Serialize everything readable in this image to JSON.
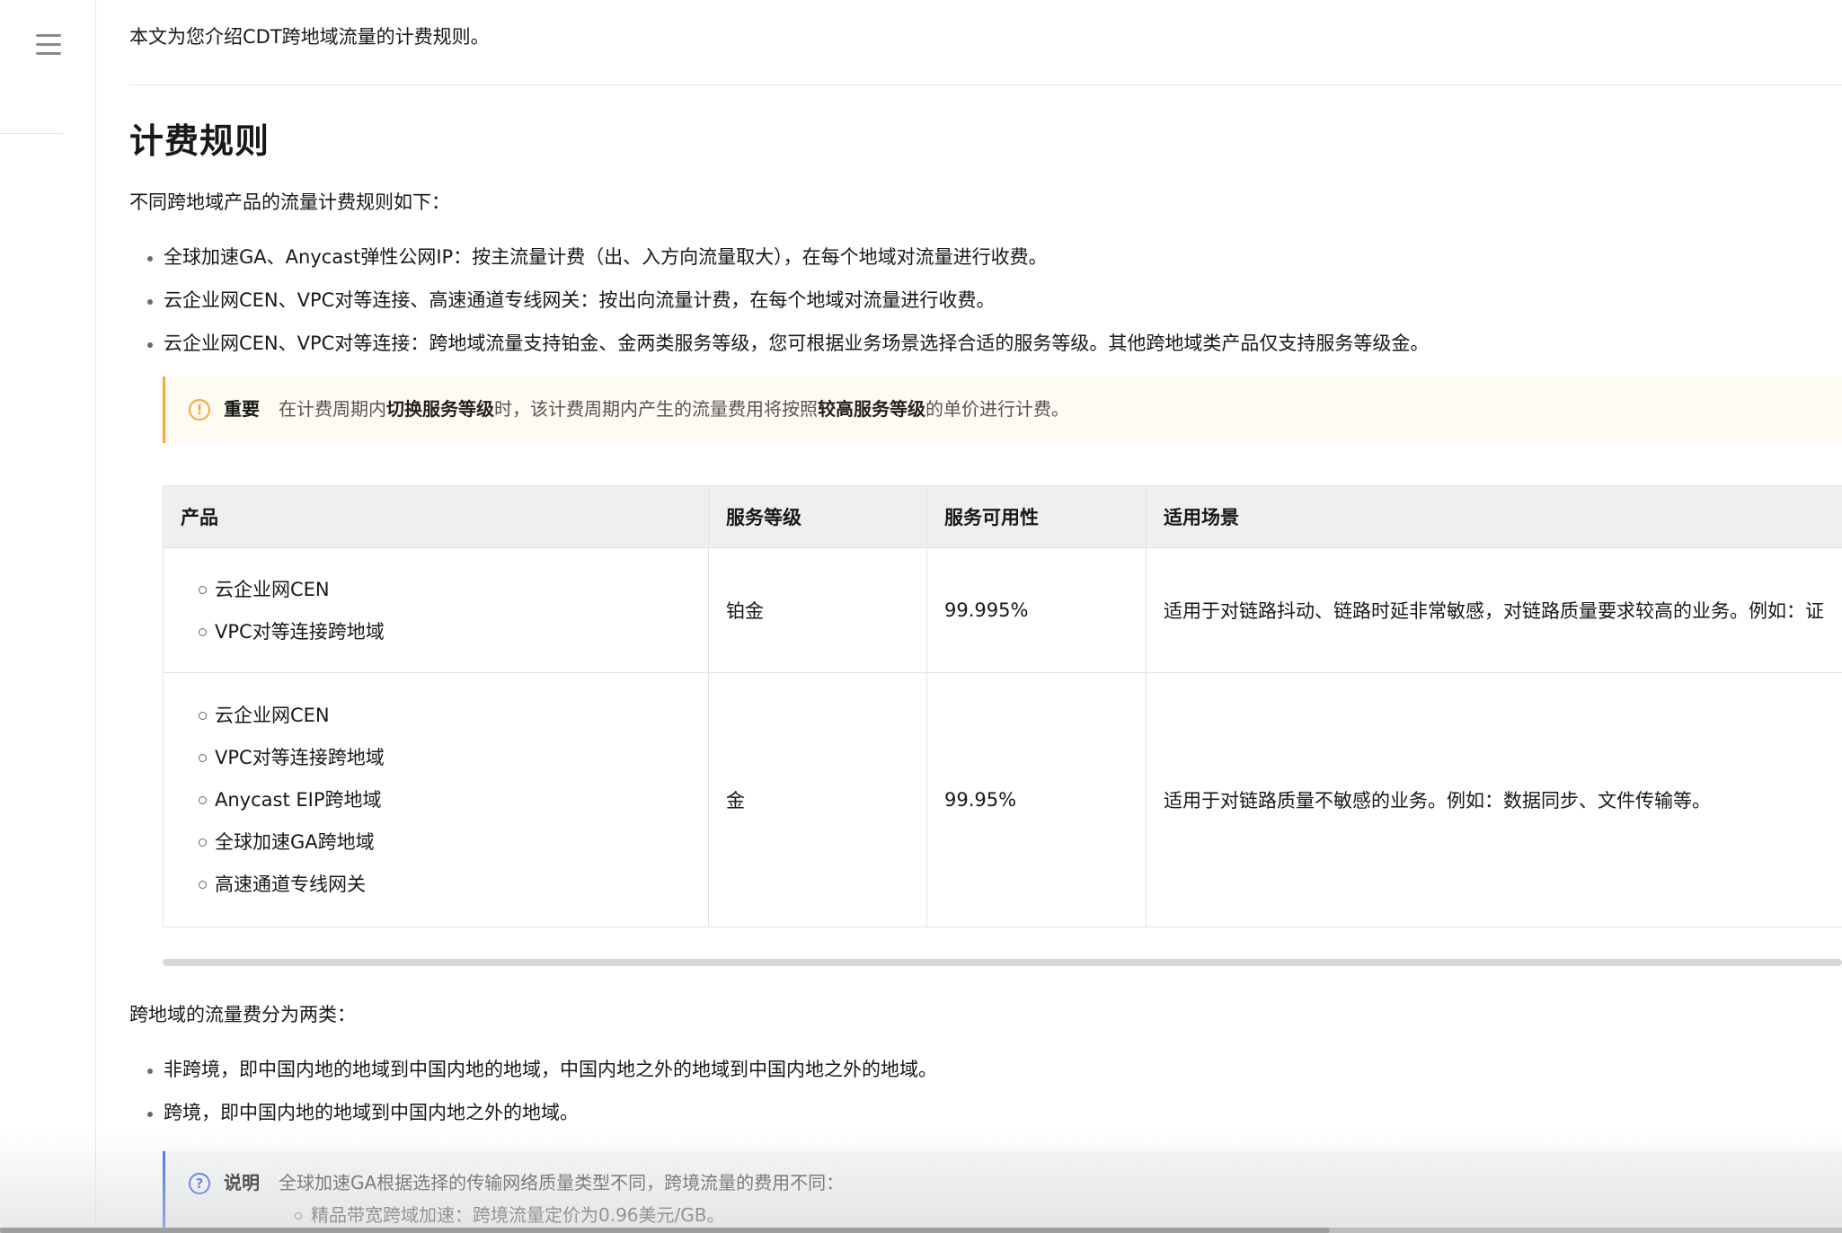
{
  "left_rail": {
    "menu_icon": "hamburger-menu-icon"
  },
  "doc": {
    "intro": "本文为您介绍CDT跨地域流量的计费规则。",
    "section_title": "计费规则",
    "rules_lead": "不同跨地域产品的流量计费规则如下：",
    "rules": [
      "全球加速GA、Anycast弹性公网IP：按主流量计费（出、入方向流量取大），在每个地域对流量进行收费。",
      "云企业网CEN、VPC对等连接、高速通道专线网关：按出向流量计费，在每个地域对流量进行收费。",
      "云企业网CEN、VPC对等连接：跨地域流量支持铂金、金两类服务等级，您可根据业务场景选择合适的服务等级。其他跨地域类产品仅支持服务等级金。"
    ],
    "important": {
      "title": "重要",
      "text_1": "在计费周期内",
      "strong_1": "切换服务等级",
      "text_2": "时，该计费周期内产生的流量费用将按照",
      "strong_2": "较高服务等级",
      "text_3": "的单价进行计费。"
    },
    "table": {
      "headers": [
        "产品",
        "服务等级",
        "服务可用性",
        "适用场景"
      ],
      "rows": [
        {
          "products": [
            "云企业网CEN",
            "VPC对等连接跨地域"
          ],
          "level": "铂金",
          "availability": "99.995%",
          "scenario": "适用于对链路抖动、链路时延非常敏感，对链路质量要求较高的业务。例如：证"
        },
        {
          "products": [
            "云企业网CEN",
            "VPC对等连接跨地域",
            "Anycast EIP跨地域",
            "全球加速GA跨地域",
            "高速通道专线网关"
          ],
          "level": "金",
          "availability": "99.95%",
          "scenario": "适用于对链路质量不敏感的业务。例如：数据同步、文件传输等。"
        }
      ]
    },
    "fee_lead": "跨地域的流量费分为两类：",
    "fee_types": [
      "非跨境，即中国内地的地域到中国内地的地域，中国内地之外的地域到中国内地之外的地域。",
      "跨境，即中国内地的地域到中国内地之外的地域。"
    ],
    "explain": {
      "title": "说明",
      "text": "全球加速GA根据选择的传输网络质量类型不同，跨境流量的费用不同：",
      "items": [
        "精品带宽跨域加速：跨境流量定价为0.96美元/GB。"
      ]
    }
  }
}
